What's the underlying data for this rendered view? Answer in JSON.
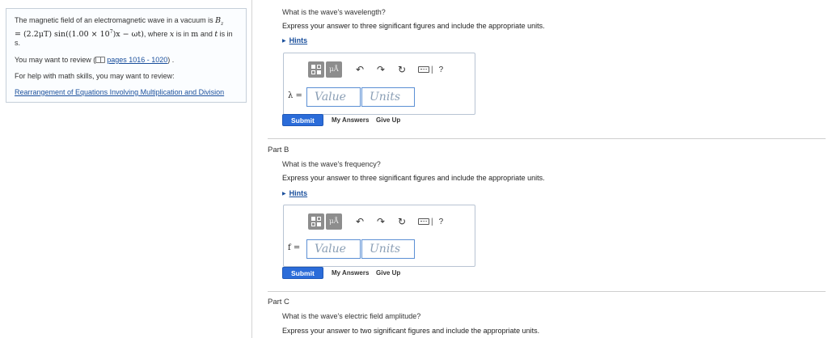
{
  "sidebar": {
    "problem_text_1": "The magnetic field of an electromagnetic wave in a vacuum is ",
    "field_symbol": "B",
    "field_sub": "z",
    "equation_prefix": "= (2.2",
    "mu_unit": "μT",
    "equation_sin": ") sin((1.00 × 10",
    "exp": "7",
    "equation_rest": ")x − ωt)",
    "where_text": ", where ",
    "var_x": "x",
    "is_in": " is in ",
    "unit_m": "m",
    "and_text": " and ",
    "var_t": "t",
    "is_in2": " is in",
    "unit_s": "s.",
    "review_prefix": "You may want to review (",
    "review_link": "pages 1016 - 1020",
    "review_suffix": ") .",
    "help_text": "For help with math skills, you may want to review:",
    "help_link": "Rearrangement of Equations Involving Multiplication and Division"
  },
  "partA": {
    "question": "What is the wave's wavelength?",
    "instruction": "Express your answer to three significant figures and include the appropriate units.",
    "hints": "Hints",
    "mu_label": "μÅ",
    "help": "?",
    "var_label": "λ =",
    "value_placeholder": "Value",
    "units_placeholder": "Units",
    "submit": "Submit",
    "my_answers": "My Answers",
    "give_up": "Give Up"
  },
  "partB": {
    "title": "Part B",
    "question": "What is the wave's frequency?",
    "instruction": "Express your answer to three significant figures and include the appropriate units.",
    "hints": "Hints",
    "mu_label": "μÅ",
    "help": "?",
    "var_label": "f =",
    "value_placeholder": "Value",
    "units_placeholder": "Units",
    "submit": "Submit",
    "my_answers": "My Answers",
    "give_up": "Give Up"
  },
  "partC": {
    "title": "Part C",
    "question": "What is the wave's electric field amplitude?",
    "instruction": "Express your answer to two significant figures and include the appropriate units."
  },
  "colors": {
    "link": "#1a4f9c",
    "submit": "#2b6cd9",
    "field_border": "#5b8fd4"
  },
  "icons": [
    "book-icon",
    "templates-icon",
    "undo-icon",
    "redo-icon",
    "reset-icon",
    "keyboard-icon",
    "help-icon",
    "hint-triangle-icon"
  ]
}
